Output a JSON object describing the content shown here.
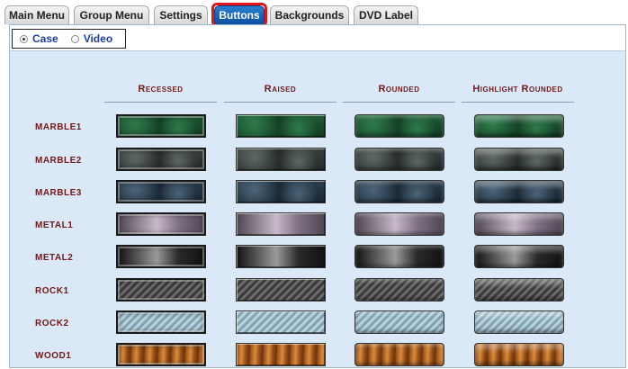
{
  "tabs": [
    {
      "label": "Main Menu",
      "active": false
    },
    {
      "label": "Group Menu",
      "active": false
    },
    {
      "label": "Settings",
      "active": false
    },
    {
      "label": "Buttons",
      "active": true
    },
    {
      "label": "Backgrounds",
      "active": false
    },
    {
      "label": "DVD Label",
      "active": false
    }
  ],
  "mode": {
    "options": [
      {
        "label": "Case",
        "selected": true
      },
      {
        "label": "Video",
        "selected": false
      }
    ]
  },
  "columns": [
    "Recessed",
    "Raised",
    "Rounded",
    "Highlight Rounded"
  ],
  "rows": [
    {
      "label": "MARBLE1",
      "colors": [
        "#1f5a35",
        "#2e7a4a",
        "#123d24"
      ]
    },
    {
      "label": "MARBLE2",
      "colors": [
        "#3c4242",
        "#5e6666",
        "#242929"
      ]
    },
    {
      "label": "MARBLE3",
      "colors": [
        "#2b3d4c",
        "#4b6478",
        "#1a2733"
      ]
    },
    {
      "label": "METAL1",
      "colors": [
        "#7f7184",
        "#c7b9c9",
        "#4e4552"
      ]
    },
    {
      "label": "METAL2",
      "colors": [
        "#2a2a2a",
        "#9a9a9a",
        "#111111"
      ]
    },
    {
      "label": "ROCK1",
      "colors": [
        "#444444",
        "#7a7a7a",
        "#2b2b2b"
      ]
    },
    {
      "label": "ROCK2",
      "colors": [
        "#8fb0c0",
        "#c9dfe8",
        "#6e8e9e"
      ]
    },
    {
      "label": "WOOD1",
      "colors": [
        "#8e4a16",
        "#d98c3e",
        "#6a3208"
      ]
    }
  ]
}
